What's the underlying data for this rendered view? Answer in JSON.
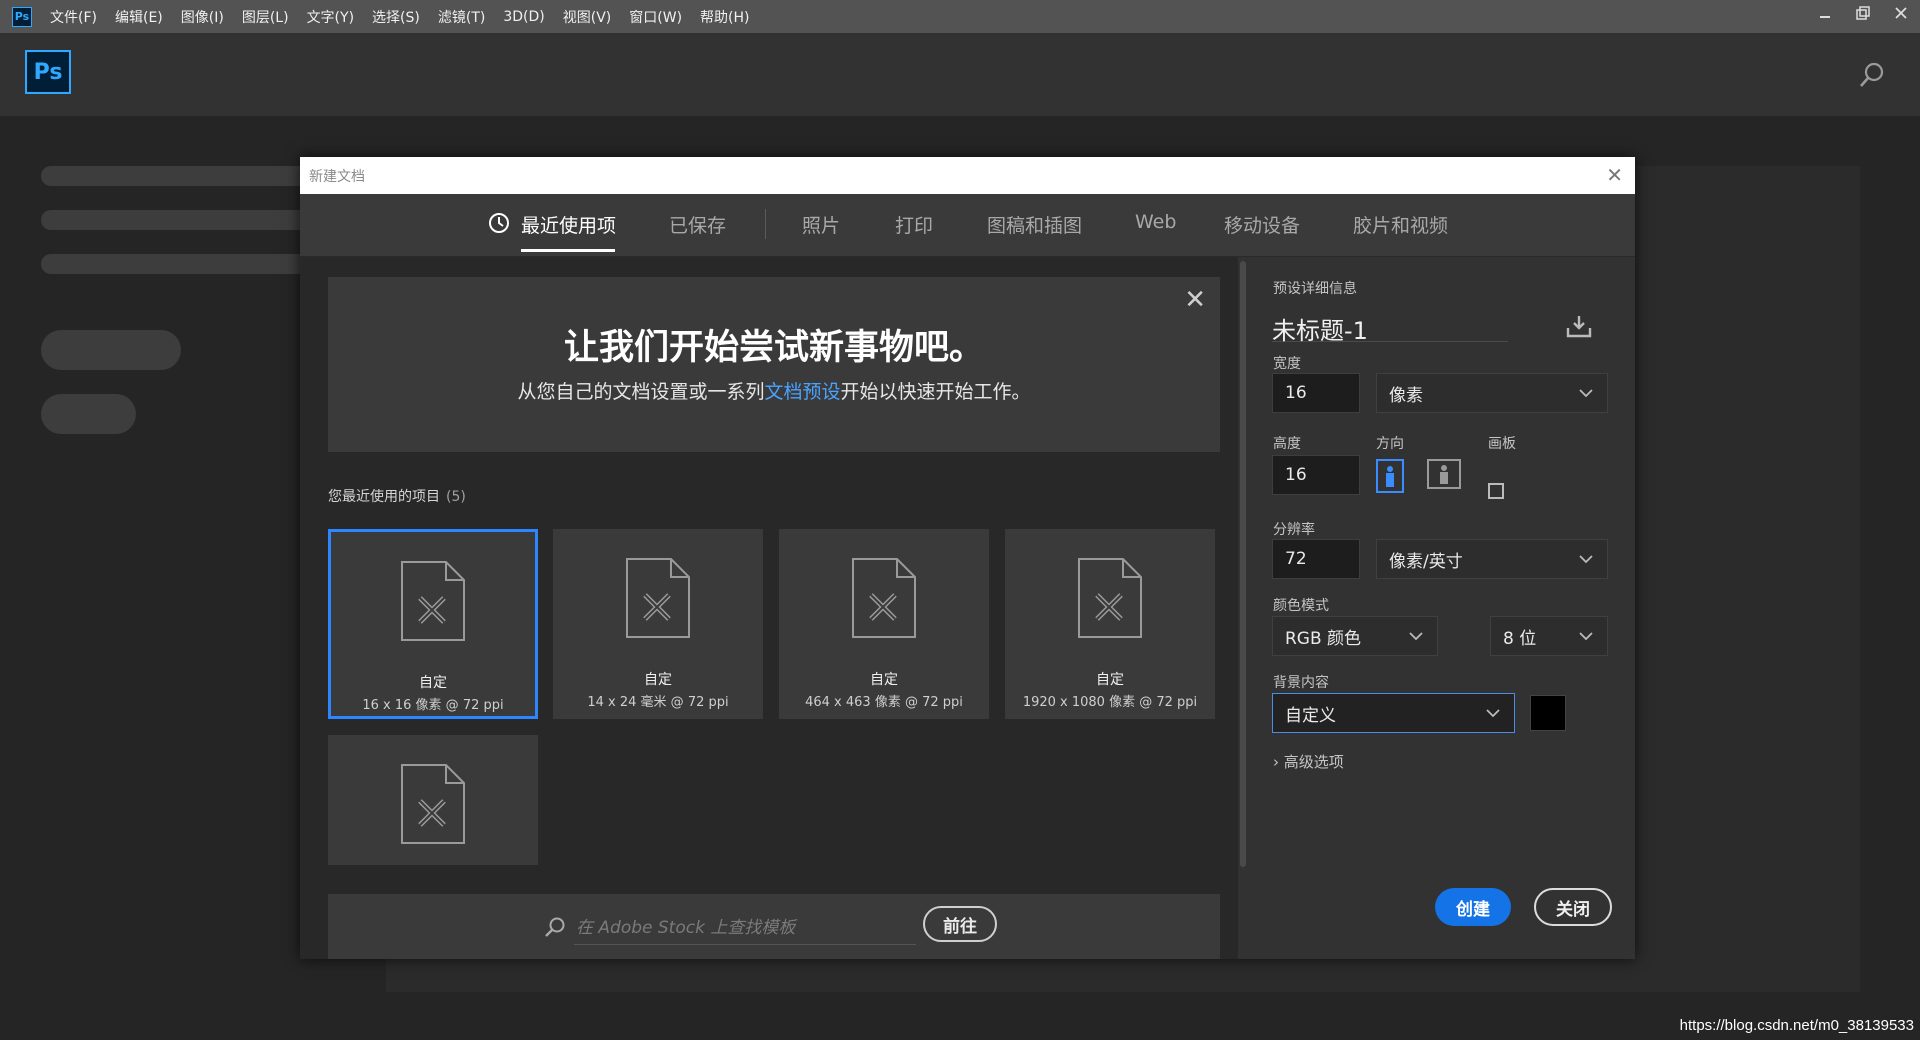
{
  "menubar": {
    "app_icon": "Ps",
    "items": [
      "文件(F)",
      "编辑(E)",
      "图像(I)",
      "图层(L)",
      "文字(Y)",
      "选择(S)",
      "滤镜(T)",
      "3D(D)",
      "视图(V)",
      "窗口(W)",
      "帮助(H)"
    ],
    "window_controls": [
      "minimize-icon",
      "restore-icon",
      "close-icon"
    ]
  },
  "header": {
    "logo": "Ps",
    "search_icon": "search-icon"
  },
  "dialog": {
    "title": "新建文档",
    "tabs": [
      "最近使用项",
      "已保存",
      "照片",
      "打印",
      "图稿和插图",
      "Web",
      "移动设备",
      "胶片和视频"
    ],
    "active_tab": "最近使用项",
    "welcome": {
      "title": "让我们开始尝试新事物吧。",
      "subtitle_before": "从您自己的文档设置或一系列",
      "subtitle_link": "文档预设",
      "subtitle_after": "开始以快速开始工作。"
    },
    "recent": {
      "label": "您最近使用的项目",
      "count": "(5)",
      "items": [
        {
          "name": "自定",
          "size": "16 x 16 像素 @ 72 ppi"
        },
        {
          "name": "自定",
          "size": "14 x 24 毫米 @ 72 ppi"
        },
        {
          "name": "自定",
          "size": "464 x 463 像素 @ 72 ppi"
        },
        {
          "name": "自定",
          "size": "1920 x 1080 像素 @ 72 ppi"
        },
        {
          "name": "",
          "size": ""
        }
      ]
    },
    "stock": {
      "placeholder": "在 Adobe Stock 上查找模板",
      "go_label": "前往"
    },
    "preset": {
      "section_label": "预设详细信息",
      "name": "未标题-1",
      "width_label": "宽度",
      "width_value": "16",
      "width_unit": "像素",
      "height_label": "高度",
      "height_value": "16",
      "orientation_label": "方向",
      "artboard_label": "画板",
      "resolution_label": "分辨率",
      "resolution_value": "72",
      "resolution_unit": "像素/英寸",
      "color_mode_label": "颜色模式",
      "color_mode_value": "RGB 颜色",
      "bit_depth_value": "8 位",
      "background_label": "背景内容",
      "background_value": "自定义",
      "background_color": "#000000",
      "advanced_label": "高级选项",
      "create_label": "创建",
      "close_label": "关闭"
    }
  },
  "watermark": "https://blog.csdn.net/m0_38139533",
  "colors": {
    "accent": "#1473e6",
    "selection": "#2d86ff",
    "link": "#4aa3ff",
    "ps_blue": "#31a8ff"
  }
}
